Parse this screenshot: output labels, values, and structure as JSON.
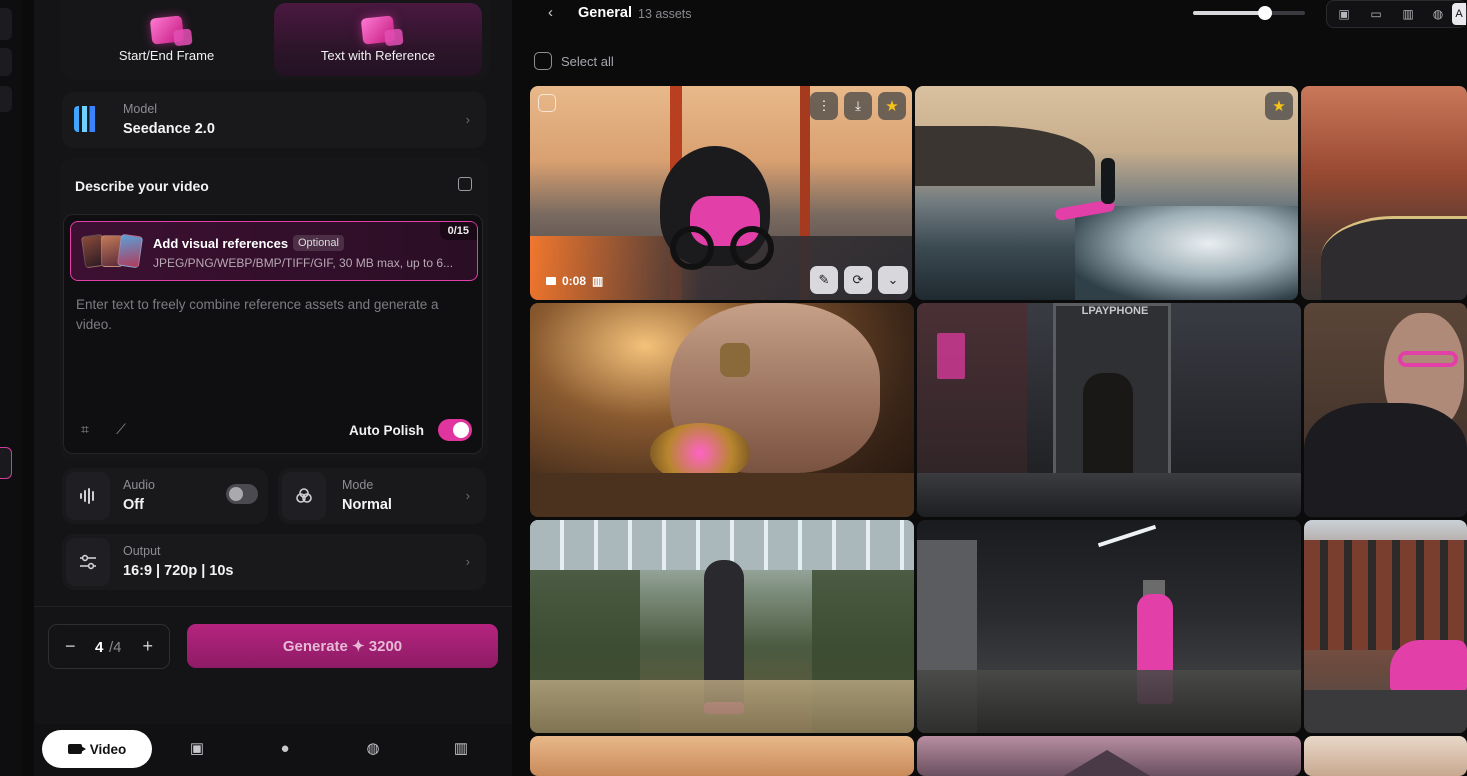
{
  "panel": {
    "tabs": [
      {
        "label": "Start/End Frame"
      },
      {
        "label": "Text with Reference"
      }
    ],
    "model": {
      "label": "Model",
      "value": "Seedance 2.0"
    },
    "describe": {
      "title": "Describe your video",
      "refs_title": "Add visual references",
      "refs_optional": "Optional",
      "refs_formats": "JPEG/PNG/WEBP/BMP/TIFF/GIF, 30 MB max, up to 6...",
      "refs_count": "0/15",
      "placeholder": "Enter text to freely combine reference assets and generate a video.",
      "auto_polish": "Auto Polish"
    },
    "audio": {
      "label": "Audio",
      "value": "Off"
    },
    "mode": {
      "label": "Mode",
      "value": "Normal"
    },
    "output": {
      "label": "Output",
      "value": "16:9 | 720p | 10s"
    },
    "count": {
      "current": "4",
      "divider": "/4"
    },
    "generate_label": "Generate ✦ 3200",
    "nav": {
      "video_label": "Video"
    }
  },
  "gallery": {
    "title": "General",
    "count": "13 assets",
    "select_all": "Select all",
    "first_tile_duration": "0:08",
    "phone_sign": "LPAYPHONE",
    "filter_selected": "A",
    "accent": "#e0349f"
  }
}
